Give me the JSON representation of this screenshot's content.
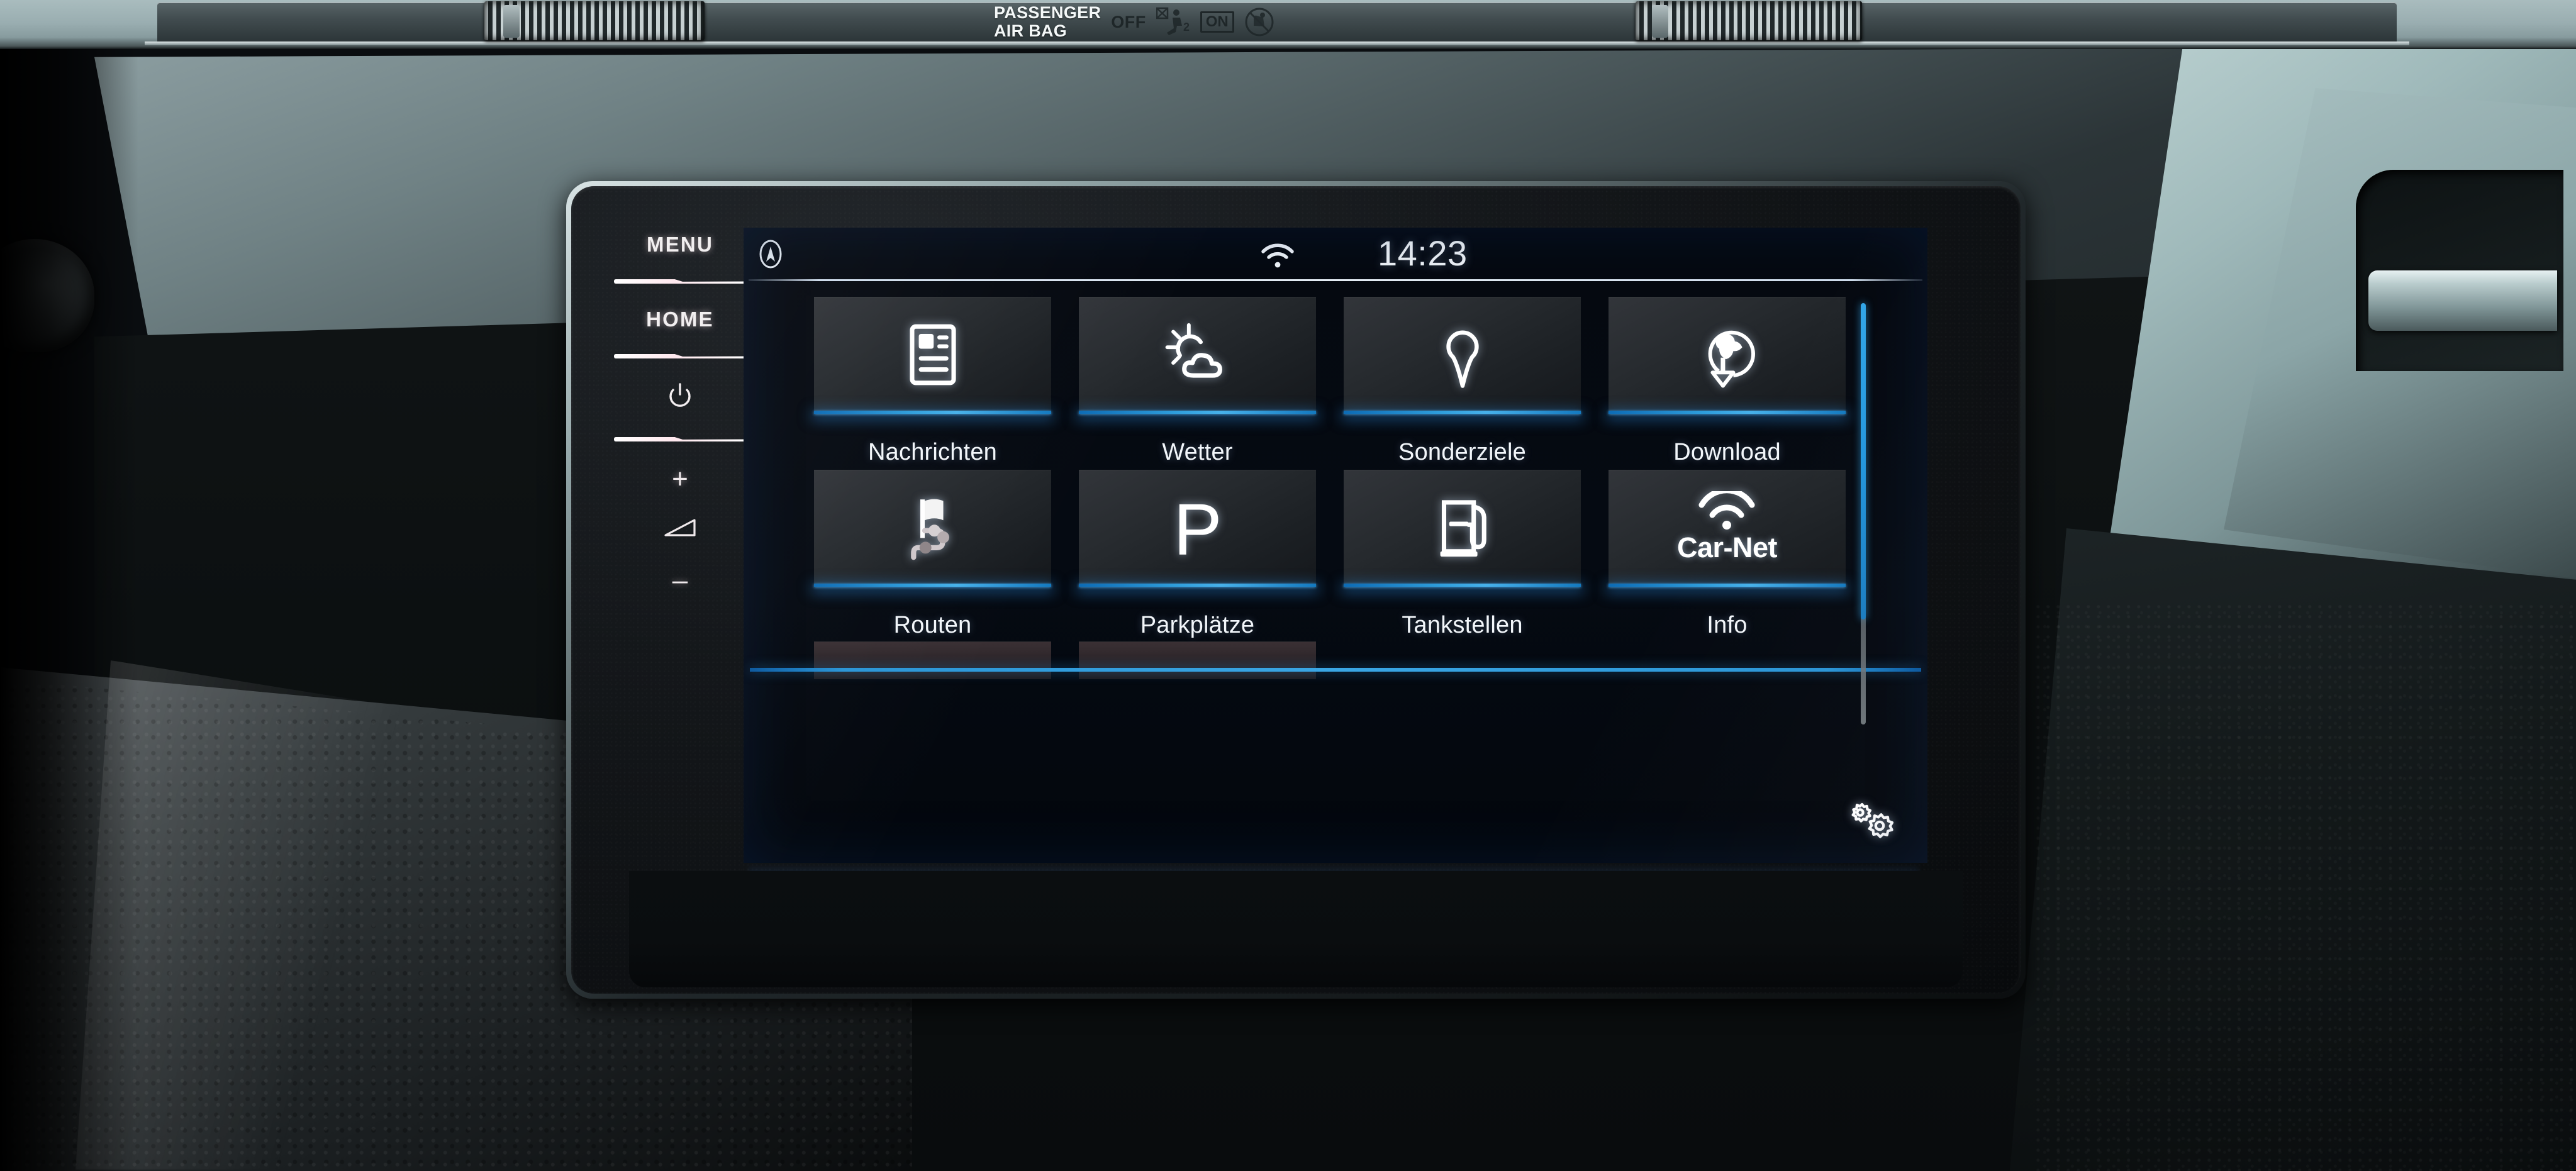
{
  "vehicle_trim": {
    "airbag_plate": {
      "line1": "PASSENGER",
      "line2": "AIR BAG",
      "off_label": "OFF",
      "on_label": "ON",
      "off_icon": "airbag-off-pictogram-icon",
      "on_icon": "airbag-on-crossed-child-seat-icon"
    }
  },
  "hard_keys": {
    "menu_label": "MENU",
    "home_label": "HOME",
    "power_icon": "power-icon",
    "volume_up_label": "+",
    "volume_icon": "volume-wedge-icon",
    "volume_down_label": "–"
  },
  "screen": {
    "status_bar": {
      "nav_icon": "compass-navigation-icon",
      "wifi_icon": "wifi-icon",
      "time": "14:23"
    },
    "scrollbar": {
      "thumb_fraction": 0.75
    },
    "settings_icon": "gears-settings-icon",
    "accent_color": "#2d9be0",
    "tile_bg_color": "#282c30",
    "text_color": "#f2f6fa",
    "tiles": [
      {
        "label": "Nachrichten",
        "icon": "news-article-icon"
      },
      {
        "label": "Wetter",
        "icon": "sun-cloud-weather-icon"
      },
      {
        "label": "Sonderziele",
        "icon": "map-pin-icon"
      },
      {
        "label": "Download",
        "icon": "globe-download-arrow-icon"
      },
      {
        "label": "Routen",
        "icon": "flag-route-waypoints-icon"
      },
      {
        "label": "Parkplätze",
        "icon": "parking-p-icon"
      },
      {
        "label": "Tankstellen",
        "icon": "fuel-pump-icon"
      },
      {
        "label": "Info",
        "icon": "car-net-wifi-icon",
        "icon_text": "Car-Net"
      }
    ],
    "partial_row": [
      {
        "visible": true
      },
      {
        "visible": true
      },
      {
        "visible": false
      },
      {
        "visible": false
      }
    ]
  }
}
